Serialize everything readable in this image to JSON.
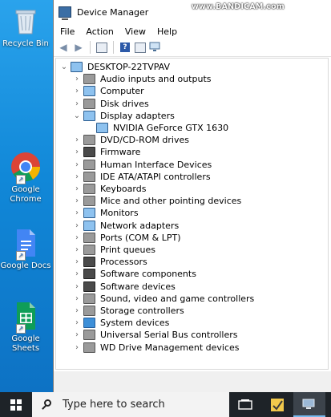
{
  "desktop_icons": [
    {
      "label": "Recycle Bin",
      "icon": "recycle-bin-icon"
    },
    {
      "label": "Google Chrome",
      "icon": "chrome-icon"
    },
    {
      "label": "Google Docs",
      "icon": "google-docs-icon"
    },
    {
      "label": "Google Sheets",
      "icon": "google-sheets-icon"
    }
  ],
  "window": {
    "title": "Device Manager",
    "watermark": "www.BANDICAM.com",
    "menu": [
      "File",
      "Action",
      "View",
      "Help"
    ]
  },
  "tree": {
    "root": "DESKTOP-22TVPAV",
    "items": [
      {
        "label": "Audio inputs and outputs",
        "icon": "speaker-icon",
        "expanded": false
      },
      {
        "label": "Computer",
        "icon": "computer-icon",
        "expanded": false
      },
      {
        "label": "Disk drives",
        "icon": "disk-drive-icon",
        "expanded": false
      },
      {
        "label": "Display adapters",
        "icon": "display-adapter-icon",
        "expanded": true,
        "children": [
          {
            "label": "NVIDIA GeForce GTX 1630",
            "icon": "display-adapter-icon"
          }
        ]
      },
      {
        "label": "DVD/CD-ROM drives",
        "icon": "dvd-drive-icon",
        "expanded": false
      },
      {
        "label": "Firmware",
        "icon": "firmware-icon",
        "expanded": false
      },
      {
        "label": "Human Interface Devices",
        "icon": "hid-icon",
        "expanded": false
      },
      {
        "label": "IDE ATA/ATAPI controllers",
        "icon": "ide-controller-icon",
        "expanded": false
      },
      {
        "label": "Keyboards",
        "icon": "keyboard-icon",
        "expanded": false
      },
      {
        "label": "Mice and other pointing devices",
        "icon": "mouse-icon",
        "expanded": false
      },
      {
        "label": "Monitors",
        "icon": "monitor-icon",
        "expanded": false
      },
      {
        "label": "Network adapters",
        "icon": "network-adapter-icon",
        "expanded": false
      },
      {
        "label": "Ports (COM & LPT)",
        "icon": "port-icon",
        "expanded": false
      },
      {
        "label": "Print queues",
        "icon": "printer-icon",
        "expanded": false
      },
      {
        "label": "Processors",
        "icon": "processor-icon",
        "expanded": false
      },
      {
        "label": "Software components",
        "icon": "software-component-icon",
        "expanded": false
      },
      {
        "label": "Software devices",
        "icon": "software-device-icon",
        "expanded": false
      },
      {
        "label": "Sound, video and game controllers",
        "icon": "sound-controller-icon",
        "expanded": false
      },
      {
        "label": "Storage controllers",
        "icon": "storage-controller-icon",
        "expanded": false
      },
      {
        "label": "System devices",
        "icon": "system-device-icon",
        "expanded": false
      },
      {
        "label": "Universal Serial Bus controllers",
        "icon": "usb-icon",
        "expanded": false
      },
      {
        "label": "WD Drive Management devices",
        "icon": "wd-drive-icon",
        "expanded": false
      }
    ]
  },
  "taskbar": {
    "search_placeholder": "Type here to search"
  }
}
